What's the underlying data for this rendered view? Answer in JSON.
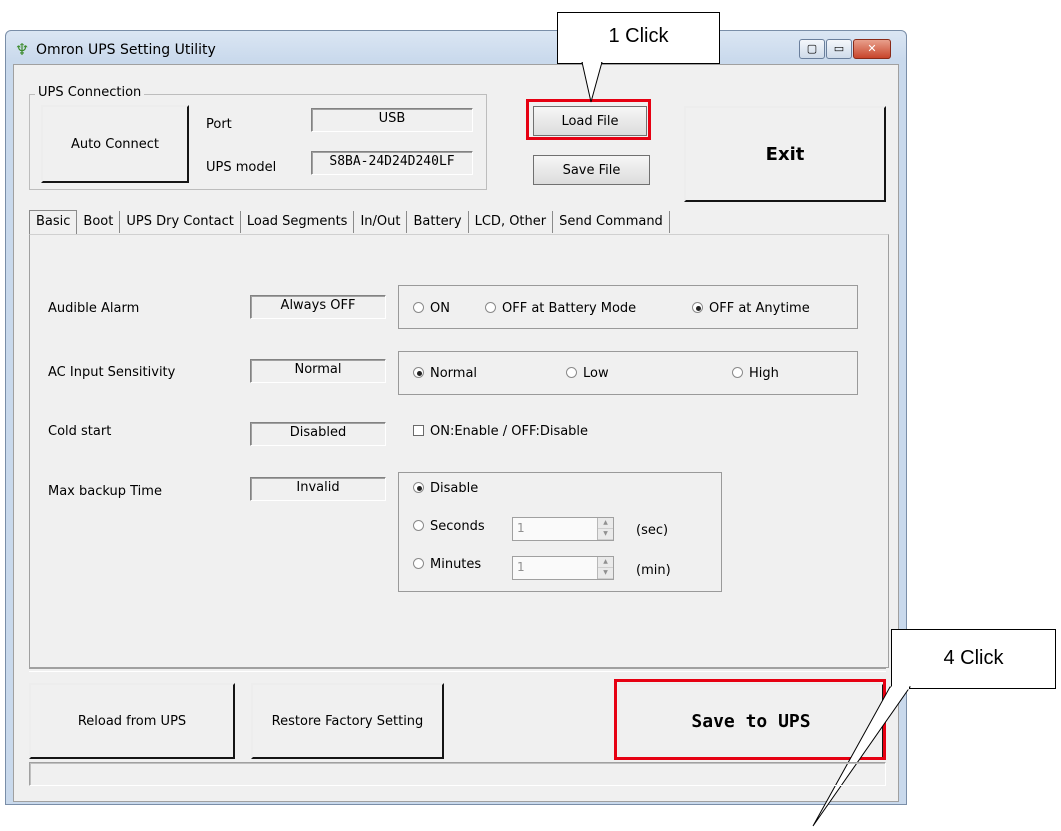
{
  "window": {
    "title": "Omron UPS Setting Utility",
    "minimize": "▭",
    "maximize": "▢",
    "close": "✕"
  },
  "connection": {
    "group_label": "UPS Connection",
    "auto_connect": "Auto Connect",
    "port_label": "Port",
    "port_value": "USB",
    "model_label": "UPS model",
    "model_value": "S8BA-24D24D240LF"
  },
  "file": {
    "load": "Load File",
    "save": "Save File"
  },
  "exit": "Exit",
  "tabs": [
    "Basic",
    "Boot",
    "UPS Dry Contact",
    "Load Segments",
    "In/Out",
    "Battery",
    "LCD, Other",
    "Send Command"
  ],
  "basic": {
    "alarm": {
      "label": "Audible Alarm",
      "current": "Always OFF",
      "opt_on": "ON",
      "opt_battery": "OFF at Battery Mode",
      "opt_anytime": "OFF at Anytime"
    },
    "sensitivity": {
      "label": "AC Input Sensitivity",
      "current": "Normal",
      "opt_normal": "Normal",
      "opt_low": "Low",
      "opt_high": "High"
    },
    "cold_start": {
      "label": "Cold start",
      "current": "Disabled",
      "checkbox": "ON:Enable / OFF:Disable"
    },
    "backup": {
      "label": "Max backup Time",
      "current": "Invalid",
      "opt_disable": "Disable",
      "opt_seconds": "Seconds",
      "seconds_value": "1",
      "seconds_unit": "(sec)",
      "opt_minutes": "Minutes",
      "minutes_value": "1",
      "minutes_unit": "(min)"
    }
  },
  "bottom": {
    "reload": "Reload from UPS",
    "restore": "Restore Factory Setting",
    "save_ups": "Save to UPS"
  },
  "callouts": {
    "first": "1 Click",
    "fourth": "4 Click"
  },
  "colors": {
    "highlight": "#e60012",
    "dialog_bg": "#f0f0f0"
  }
}
